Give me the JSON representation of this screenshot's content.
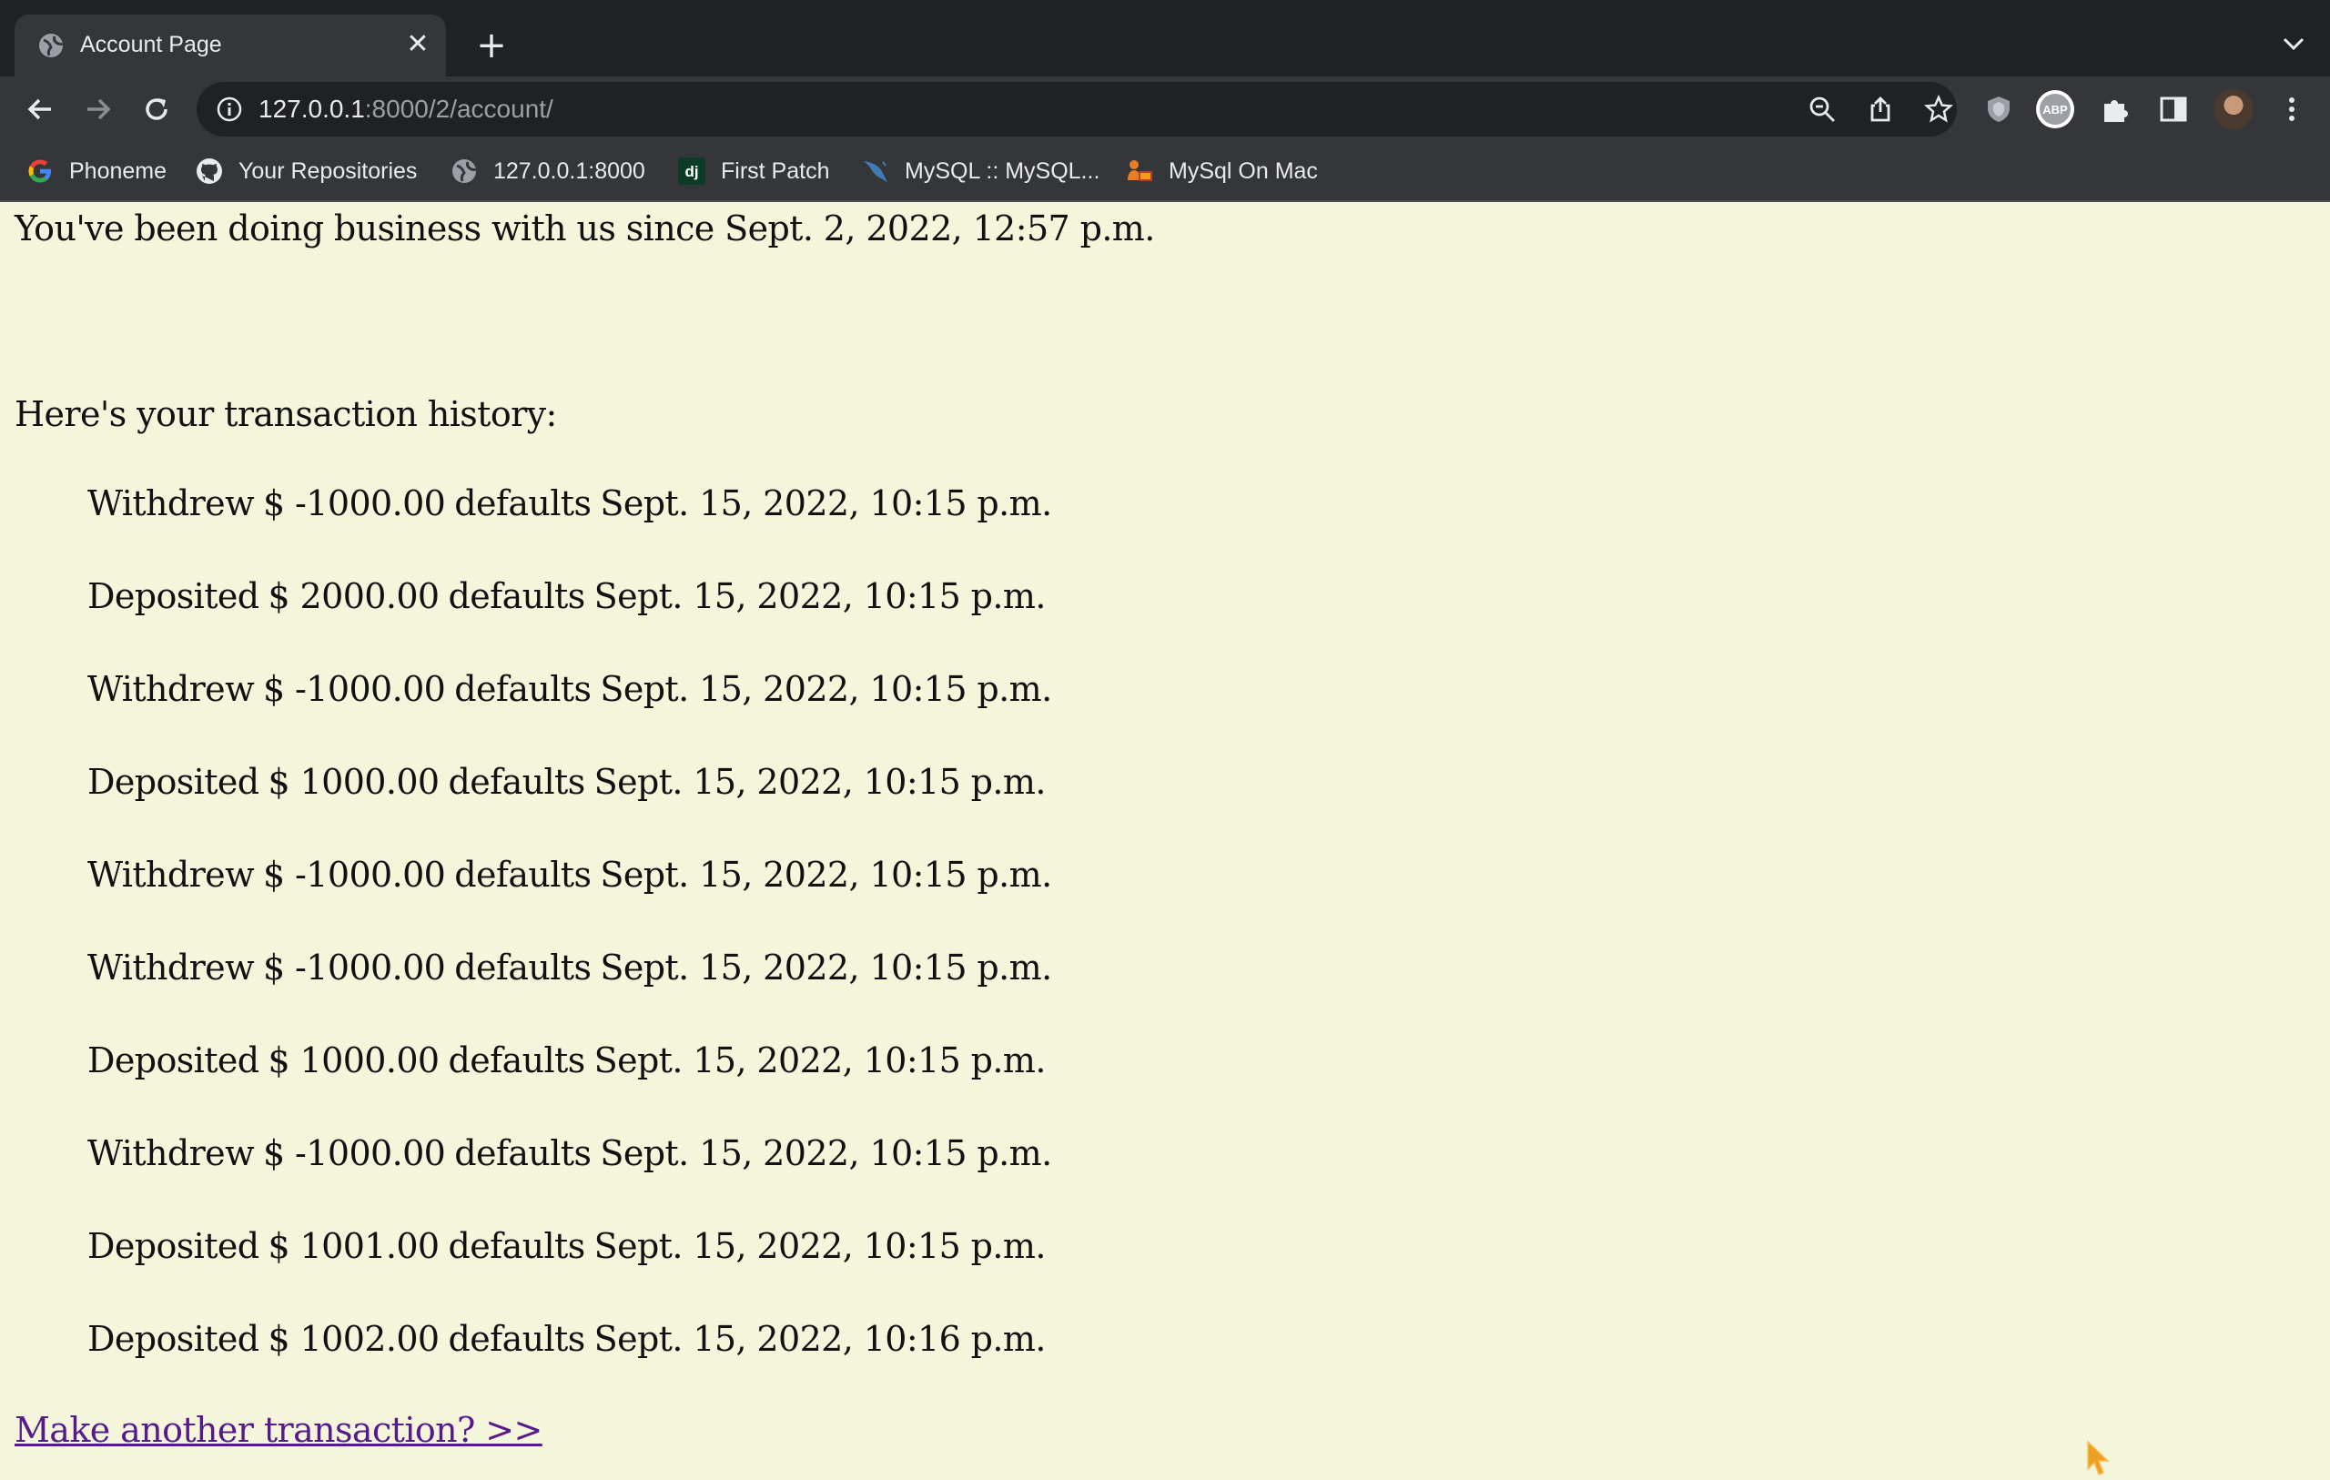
{
  "browser": {
    "tab_title": "Account Page",
    "close_glyph": "✕",
    "new_tab_glyph": "+",
    "url_host": "127.0.0.1",
    "url_rest": ":8000/2/account/",
    "bookmarks": [
      {
        "label": "Phoneme",
        "icon": "google-icon"
      },
      {
        "label": "Your Repositories",
        "icon": "github-icon"
      },
      {
        "label": "127.0.0.1:8000",
        "icon": "globe-icon"
      },
      {
        "label": "First Patch",
        "icon": "django-icon"
      },
      {
        "label": "MySQL :: MySQL...",
        "icon": "mysql-icon"
      },
      {
        "label": "MySql On Mac",
        "icon": "mysql-mac-icon"
      }
    ],
    "django_icon_text": "dj"
  },
  "page": {
    "since_text": "You've been doing business with us since Sept. 2, 2022, 12:57 p.m.",
    "history_heading": "Here's your transaction history:",
    "transactions": [
      {
        "type": "Withdrew",
        "amount": "$ -1000.00",
        "category": "defaults",
        "date": "Sept. 15, 2022, 10:15 p.m."
      },
      {
        "type": "Deposited",
        "amount": "$ 2000.00",
        "category": "defaults",
        "date": "Sept. 15, 2022, 10:15 p.m."
      },
      {
        "type": "Withdrew",
        "amount": "$ -1000.00",
        "category": "defaults",
        "date": "Sept. 15, 2022, 10:15 p.m."
      },
      {
        "type": "Deposited",
        "amount": "$ 1000.00",
        "category": "defaults",
        "date": "Sept. 15, 2022, 10:15 p.m."
      },
      {
        "type": "Withdrew",
        "amount": "$ -1000.00",
        "category": "defaults",
        "date": "Sept. 15, 2022, 10:15 p.m."
      },
      {
        "type": "Withdrew",
        "amount": "$ -1000.00",
        "category": "defaults",
        "date": "Sept. 15, 2022, 10:15 p.m."
      },
      {
        "type": "Deposited",
        "amount": "$ 1000.00",
        "category": "defaults",
        "date": "Sept. 15, 2022, 10:15 p.m."
      },
      {
        "type": "Withdrew",
        "amount": "$ -1000.00",
        "category": "defaults",
        "date": "Sept. 15, 2022, 10:15 p.m."
      },
      {
        "type": "Deposited",
        "amount": "$ 1001.00",
        "category": "defaults",
        "date": "Sept. 15, 2022, 10:15 p.m."
      },
      {
        "type": "Deposited",
        "amount": "$ 1002.00",
        "category": "defaults",
        "date": "Sept. 15, 2022, 10:16 p.m."
      }
    ],
    "link_text": "Make another transaction? >>"
  },
  "colors": {
    "page_background": "#f5f5dc",
    "link": "#551a8b",
    "chrome_dark": "#202124",
    "chrome_toolbar": "#35363a",
    "cursor": "#f0a020"
  }
}
